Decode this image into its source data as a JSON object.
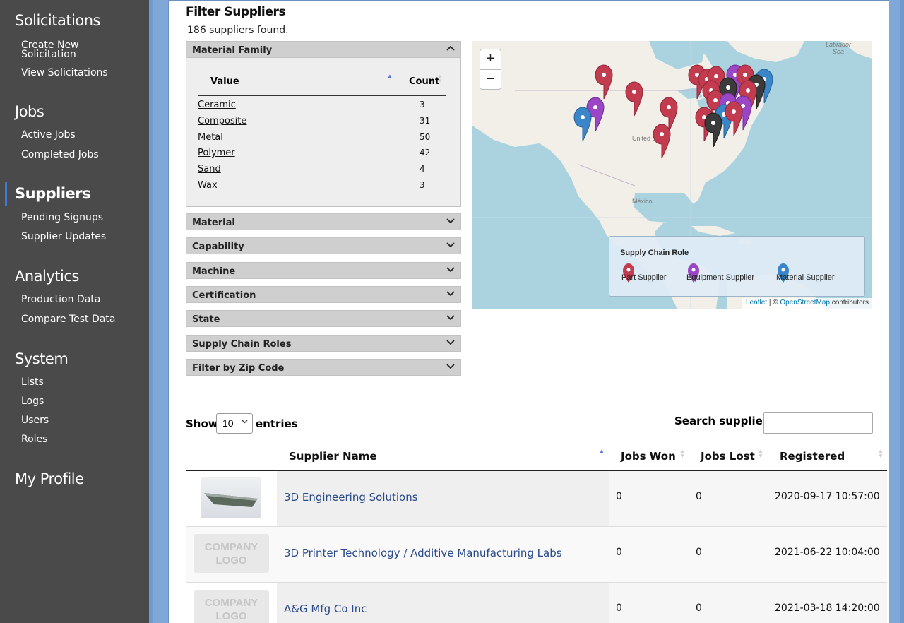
{
  "sidebar": {
    "sections": [
      {
        "title": "Solicitations",
        "items": [
          "Create New Solicitation",
          "View Solicitations"
        ]
      },
      {
        "title": "Jobs",
        "items": [
          "Active Jobs",
          "Completed Jobs"
        ]
      },
      {
        "title": "Suppliers",
        "items": [
          "Pending Signups",
          "Supplier Updates"
        ]
      },
      {
        "title": "Analytics",
        "items": [
          "Production Data",
          "Compare Test Data"
        ]
      },
      {
        "title": "System",
        "items": [
          "Lists",
          "Logs",
          "Users",
          "Roles"
        ]
      },
      {
        "title": "My Profile",
        "items": []
      }
    ],
    "create_line1": "Create New",
    "create_line2": "Solicitation",
    "active_section": "Suppliers"
  },
  "filter": {
    "title": "Filter Suppliers",
    "found": "186 suppliers found.",
    "material_family": {
      "label": "Material Family",
      "col_value": "Value",
      "col_count": "Count",
      "rows": [
        {
          "value": "Ceramic",
          "count": "3"
        },
        {
          "value": "Composite",
          "count": "31"
        },
        {
          "value": "Metal",
          "count": "50"
        },
        {
          "value": "Polymer",
          "count": "42"
        },
        {
          "value": "Sand",
          "count": "4"
        },
        {
          "value": "Wax",
          "count": "3"
        }
      ]
    },
    "collapsed": [
      "Material",
      "Capability",
      "Machine",
      "Certification",
      "State",
      "Supply Chain Roles",
      "Filter by Zip Code"
    ]
  },
  "map": {
    "zoom_in": "+",
    "zoom_out": "−",
    "label_us": "United States",
    "label_mexico": "México",
    "label_labrador": "Labrador Sea",
    "legend_title": "Supply Chain Role",
    "legend": [
      {
        "label": "Part Supplier",
        "color": "#c23b4f"
      },
      {
        "label": "Equipment Supplier",
        "color": "#9b45c7"
      },
      {
        "label": "Material Supplier",
        "color": "#3a86c8"
      }
    ],
    "attribution_leaflet": "Leaflet",
    "attribution_sep": " | © ",
    "attribution_osm": "OpenStreetMap",
    "attribution_tail": " contributors"
  },
  "table": {
    "show_label": "Show",
    "entries_value": "10",
    "entries_label": "entries",
    "search_label": "Search suppliers:",
    "columns": [
      "Supplier Name",
      "Jobs Won",
      "Jobs Lost",
      "Registered"
    ],
    "logo_placeholder": "COMPANY LOGO",
    "rows": [
      {
        "name": "3D Engineering Solutions",
        "won": "0",
        "lost": "0",
        "registered": "2020-09-17 10:57:00",
        "logo": "image"
      },
      {
        "name": "3D Printer Technology / Additive Manufacturing Labs",
        "won": "0",
        "lost": "0",
        "registered": "2021-06-22 10:04:00",
        "logo": "placeholder"
      },
      {
        "name": "A&G Mfg Co Inc",
        "won": "0",
        "lost": "0",
        "registered": "2021-03-18 14:20:00",
        "logo": "placeholder"
      }
    ]
  }
}
